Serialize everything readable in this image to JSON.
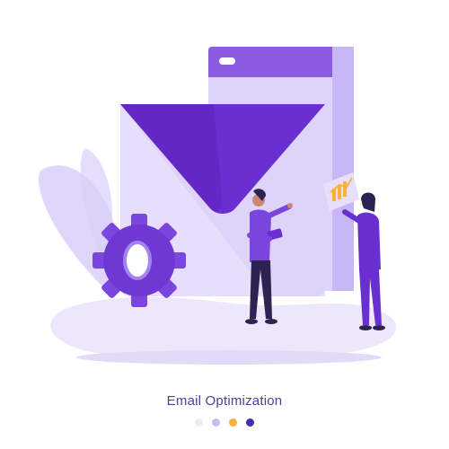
{
  "caption": "Email Optimization",
  "carousel": {
    "dots": [
      {
        "state": "inactive",
        "color": "#ececf2"
      },
      {
        "state": "inactive",
        "color": "#c8bdf2"
      },
      {
        "state": "active",
        "color": "#f7b23b"
      },
      {
        "state": "inactive",
        "color": "#3f2fb0"
      }
    ]
  },
  "colors": {
    "primary": "#6a2fd0",
    "deep": "#5a1fb8",
    "lavender": "#e3dcfb",
    "light": "#efeafd",
    "accent": "#f7b23b",
    "ground": "#e9e4fb"
  },
  "illustration": {
    "icons": [
      "email-envelope-icon",
      "browser-window-icon",
      "gear-icon",
      "donut-chart-icon",
      "bar-chart-icon",
      "leaf-icon"
    ]
  }
}
